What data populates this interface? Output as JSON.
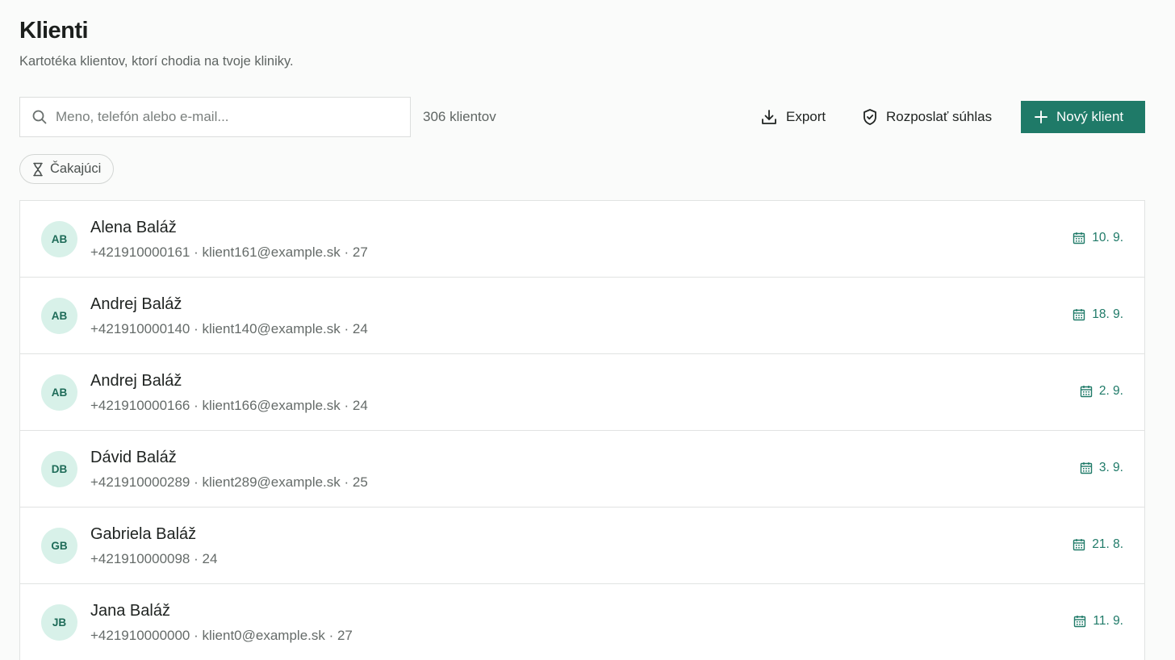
{
  "header": {
    "title": "Klienti",
    "subtitle": "Kartotéka klientov, ktorí chodia na tvoje kliniky."
  },
  "toolbar": {
    "search_placeholder": "Meno, telefón alebo e-mail...",
    "search_icon": "search-icon",
    "count_label": "306 klientov",
    "export_label": "Export",
    "export_icon": "download-icon",
    "consent_label": "Rozposlať súhlas",
    "consent_icon": "shield-check-icon",
    "new_client_label": "Nový klient",
    "new_client_icon": "plus-icon"
  },
  "filters": {
    "waiting_label": "Čakajúci",
    "waiting_icon": "hourglass-icon"
  },
  "colors": {
    "accent": "#1f7a68",
    "avatar_bg": "#d8f1e9",
    "avatar_text": "#1e6b58"
  },
  "clients": [
    {
      "initials": "AB",
      "name": "Alena Baláž",
      "meta": "+421910000161 · klient161@example.sk · 27",
      "date": "10. 9."
    },
    {
      "initials": "AB",
      "name": "Andrej Baláž",
      "meta": "+421910000140 · klient140@example.sk · 24",
      "date": "18. 9."
    },
    {
      "initials": "AB",
      "name": "Andrej Baláž",
      "meta": "+421910000166 · klient166@example.sk · 24",
      "date": "2. 9."
    },
    {
      "initials": "DB",
      "name": "Dávid Baláž",
      "meta": "+421910000289 · klient289@example.sk · 25",
      "date": "3. 9."
    },
    {
      "initials": "GB",
      "name": "Gabriela Baláž",
      "meta": "+421910000098 · 24",
      "date": "21. 8."
    },
    {
      "initials": "JB",
      "name": "Jana Baláž",
      "meta": "+421910000000 · klient0@example.sk · 27",
      "date": "11. 9."
    }
  ]
}
